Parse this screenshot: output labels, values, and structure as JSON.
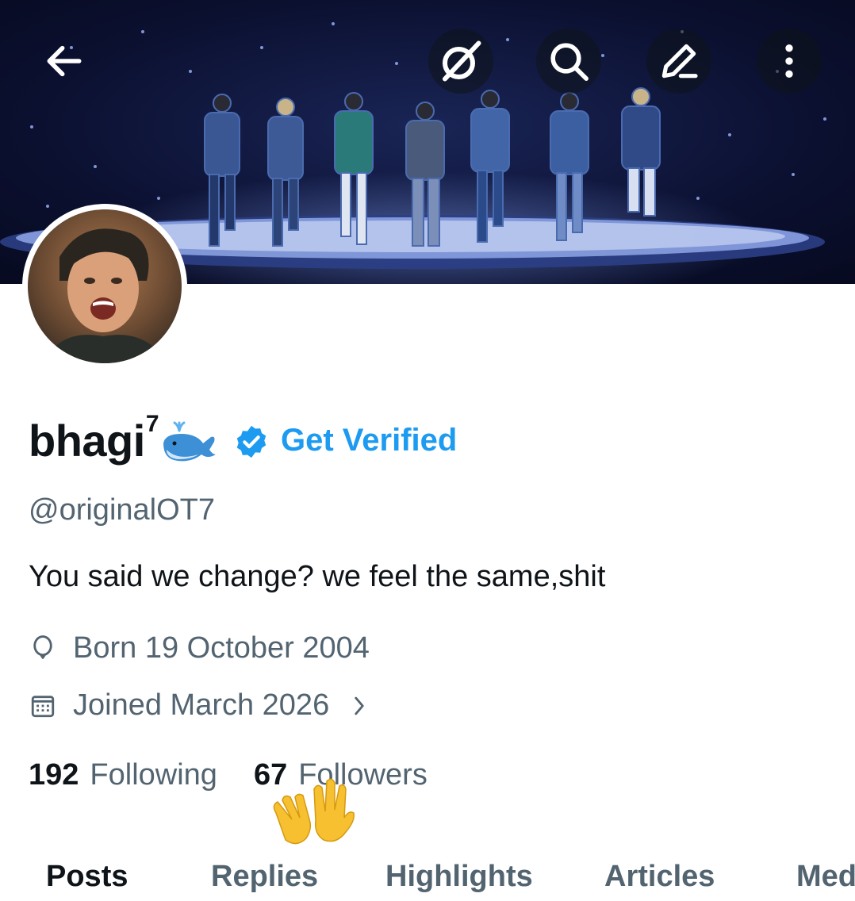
{
  "header": {
    "icons": [
      "back-arrow-icon",
      "grok-icon",
      "search-icon",
      "edit-icon",
      "more-icon"
    ]
  },
  "profile": {
    "display_name": "bhagi",
    "display_name_superscript": "7",
    "name_emoji": "spouting-whale-emoji",
    "verified_badge_color": "#1d9bf0",
    "get_verified_label": "Get Verified",
    "handle": "@originalOT7",
    "bio": "You said we change? we feel the same,shit",
    "born": "Born 19 October 2004",
    "joined": "Joined March 2026",
    "following_count": "192",
    "following_label": "Following",
    "followers_count": "67",
    "followers_label": "Followers",
    "sticker": "waving-hands-emoji"
  },
  "tabs": [
    {
      "label": "Posts",
      "active": true
    },
    {
      "label": "Replies",
      "active": false
    },
    {
      "label": "Highlights",
      "active": false
    },
    {
      "label": "Articles",
      "active": false
    },
    {
      "label": "Media",
      "active": false
    }
  ],
  "colors": {
    "primary_text": "#0f1419",
    "secondary_text": "#536471",
    "accent": "#1d9bf0"
  }
}
